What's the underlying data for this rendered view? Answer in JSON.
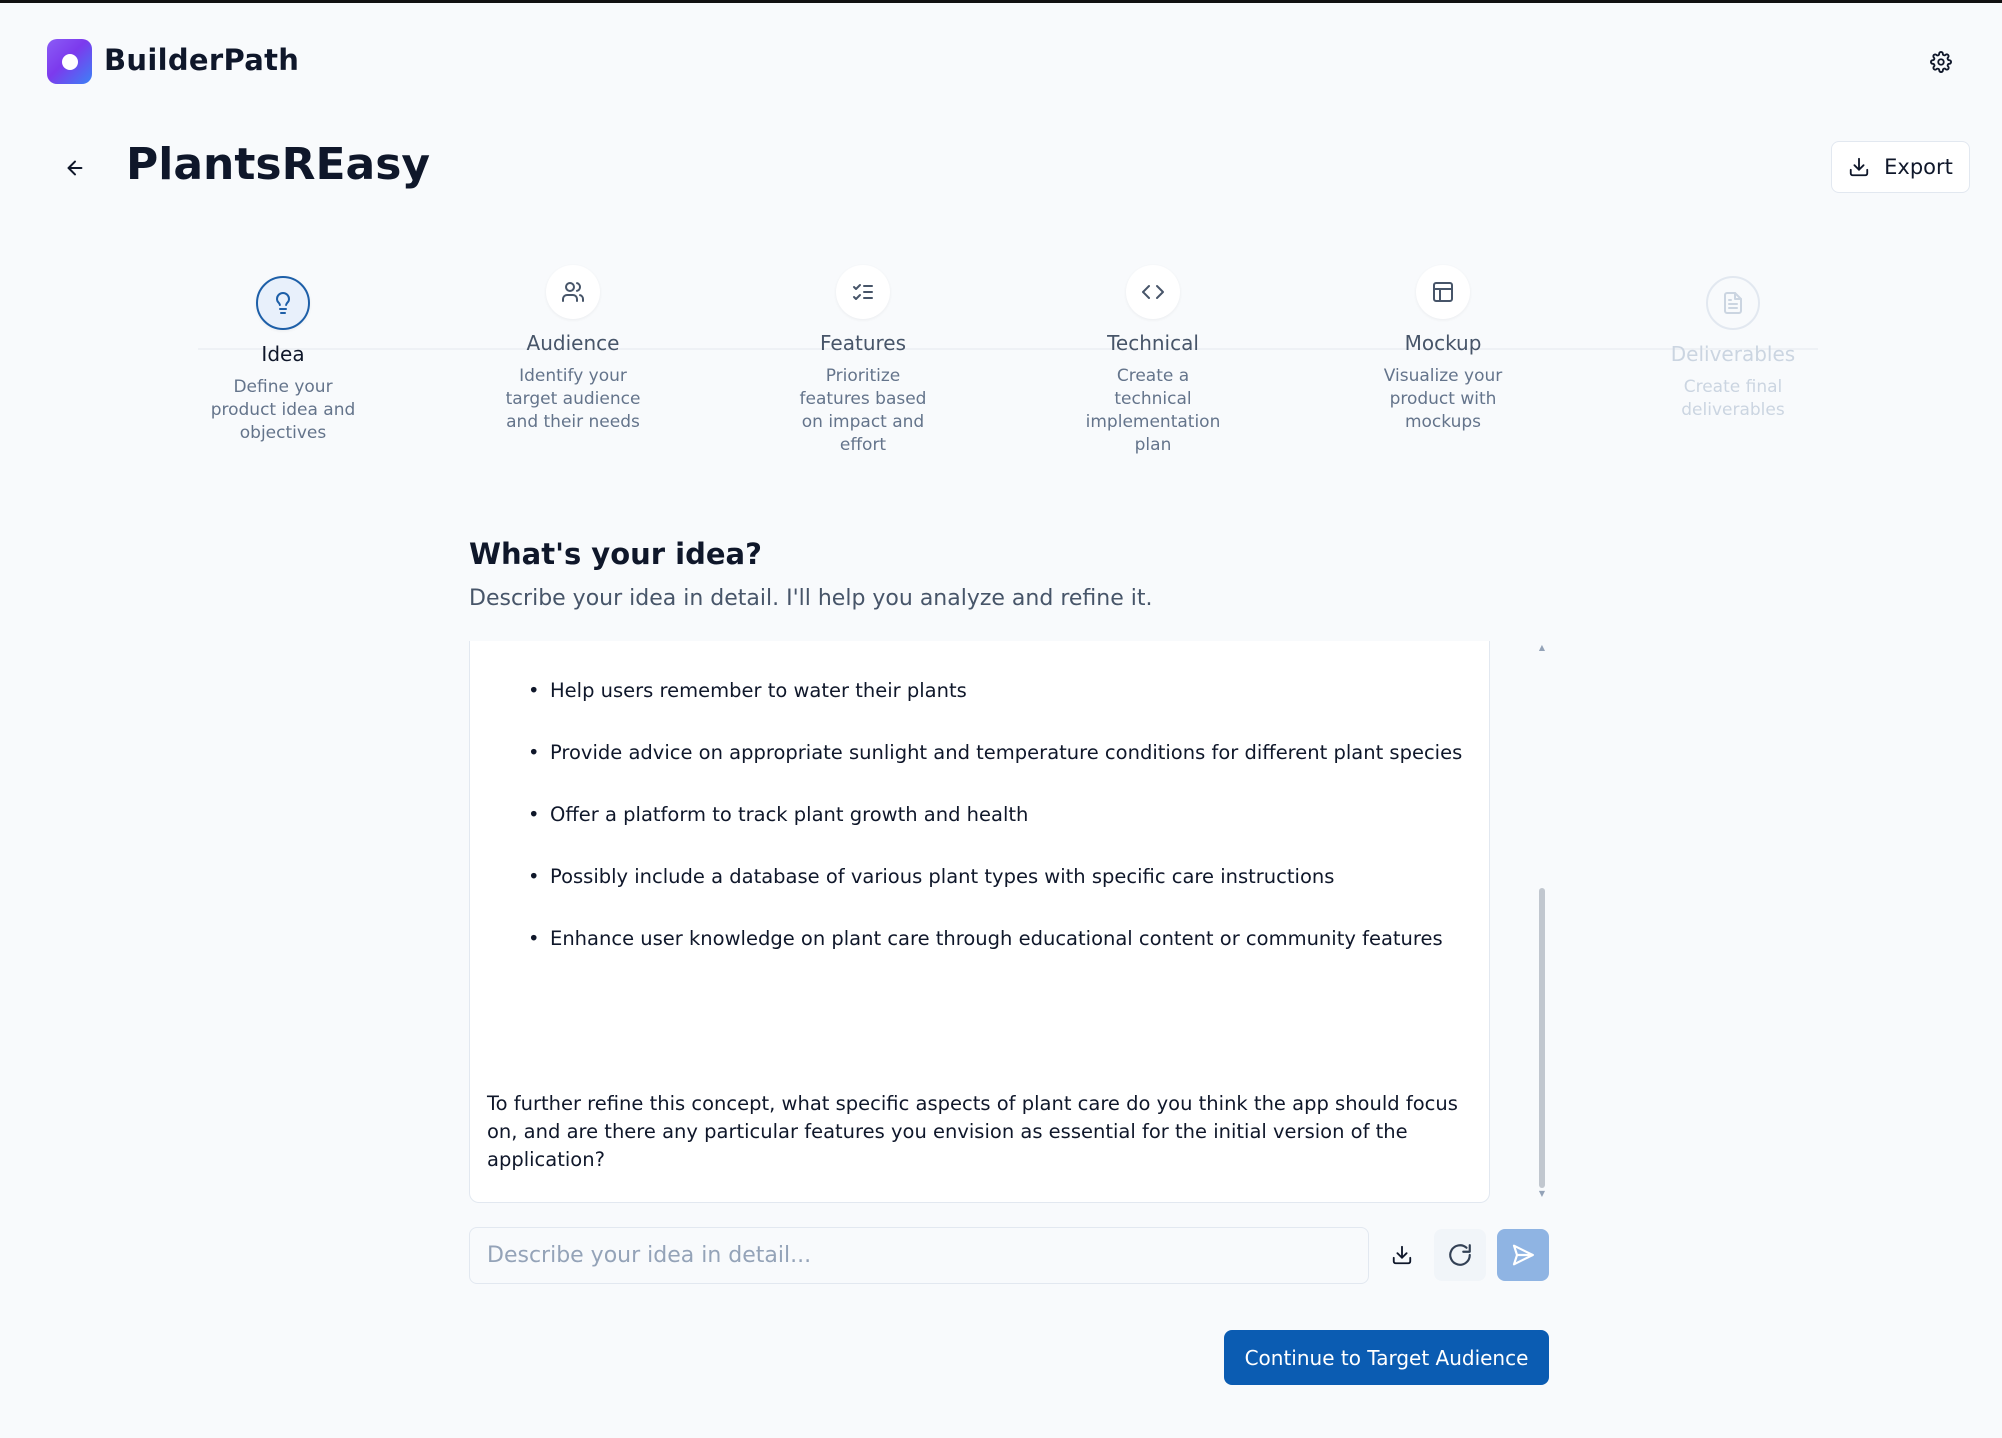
{
  "app": {
    "brand": "BuilderPath"
  },
  "header": {
    "title": "PlantsREasy",
    "export_label": "Export"
  },
  "steps": [
    {
      "label": "Idea",
      "desc": "Define your product idea and objectives",
      "icon": "lightbulb-icon",
      "state": "active"
    },
    {
      "label": "Audience",
      "desc": "Identify your target audience and their needs",
      "icon": "users-icon",
      "state": "default"
    },
    {
      "label": "Features",
      "desc": "Prioritize features based on impact and effort",
      "icon": "list-checks-icon",
      "state": "default"
    },
    {
      "label": "Technical",
      "desc": "Create a technical implementation plan",
      "icon": "code-icon",
      "state": "default"
    },
    {
      "label": "Mockup",
      "desc": "Visualize your product with mockups",
      "icon": "layout-icon",
      "state": "default"
    },
    {
      "label": "Deliverables",
      "desc": "Create final deliverables",
      "icon": "file-text-icon",
      "state": "disabled"
    }
  ],
  "main": {
    "title": "What's your idea?",
    "subtitle": "Describe your idea in detail. I'll help you analyze and refine it."
  },
  "chat": {
    "bullets": [
      "Help users remember to water their plants",
      "Provide advice on appropriate sunlight and temperature conditions for different plant species",
      "Offer a platform to track plant growth and health",
      "Possibly include a database of various plant types with specific care instructions",
      "Enhance user knowledge on plant care through educational content or community features"
    ],
    "question": "To further refine this concept, what specific aspects of plant care do you think the app should focus on, and are there any particular features you envision as essential for the initial version of the application?"
  },
  "input": {
    "placeholder": "Describe your idea in detail...",
    "value": ""
  },
  "actions": {
    "continue_label": "Continue to Target Audience"
  },
  "colors": {
    "primary": "#0b5cb2",
    "active_step": "#1d5fa8",
    "send_button": "#8fb4e3",
    "brand_gradient_start": "#8b5cf6",
    "brand_gradient_end": "#3b82f6"
  }
}
